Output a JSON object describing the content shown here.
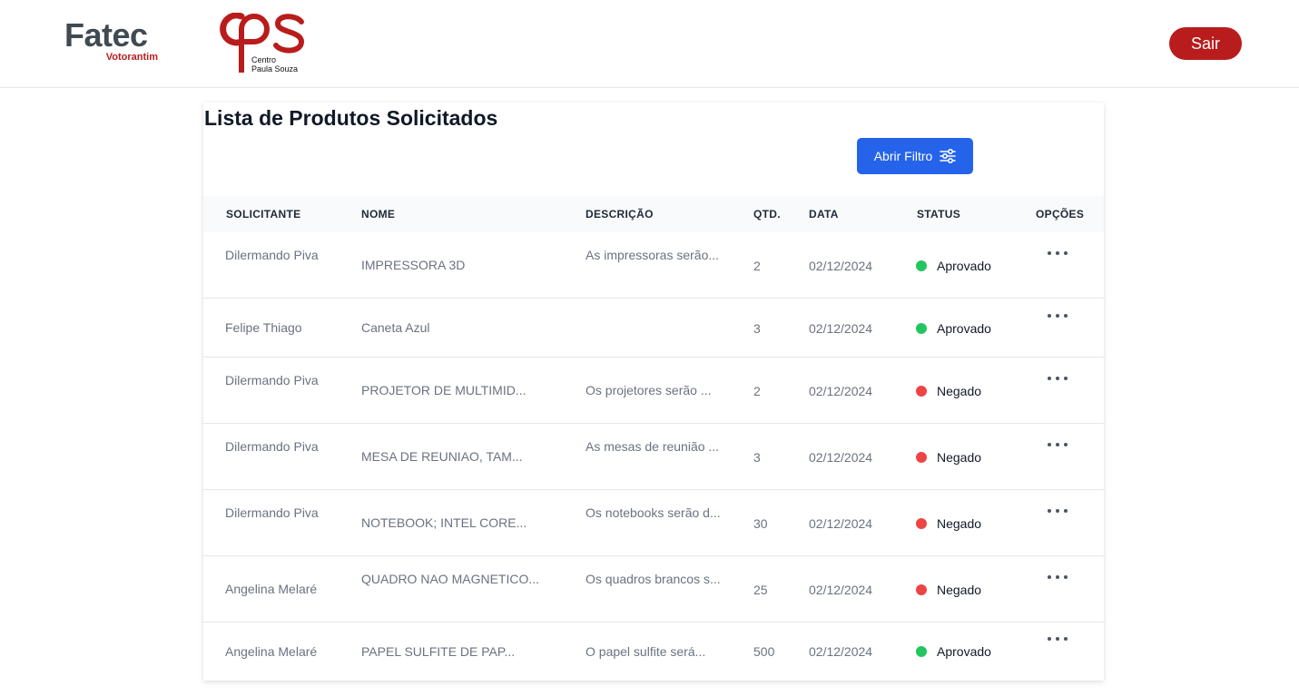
{
  "header": {
    "fatec_logo": {
      "name": "Fatec",
      "subtitle": "Votorantim"
    },
    "cps_logo": {
      "line1": "Centro",
      "line2": "Paula Souza"
    },
    "logout_label": "Sair"
  },
  "colors": {
    "primary_blue": "#2563eb",
    "brand_red": "#b91c1c",
    "approved": "#22c55e",
    "denied": "#ef4444"
  },
  "page": {
    "title": "Lista de Produtos Solicitados",
    "filter_button": {
      "label": "Abrir Filtro",
      "icon": "sliders-icon"
    }
  },
  "table": {
    "columns": [
      "SOLICITANTE",
      "NOME",
      "DESCRIÇÃO",
      "QTD.",
      "DATA",
      "STATUS",
      "OPÇÕES"
    ],
    "rows": [
      {
        "solicitante": "Dilermando Piva",
        "nome": "IMPRESSORA 3D",
        "descricao": "As impressoras serão...",
        "qtd": "2",
        "data": "02/12/2024",
        "status": "Aprovado",
        "status_type": "approved"
      },
      {
        "solicitante": "Felipe Thiago",
        "nome": "Caneta Azul",
        "descricao": "",
        "qtd": "3",
        "data": "02/12/2024",
        "status": "Aprovado",
        "status_type": "approved"
      },
      {
        "solicitante": "Dilermando Piva",
        "nome": "PROJETOR DE MULTIMID...",
        "descricao": "Os projetores serão ...",
        "qtd": "2",
        "data": "02/12/2024",
        "status": "Negado",
        "status_type": "denied"
      },
      {
        "solicitante": "Dilermando Piva",
        "nome": "MESA DE REUNIAO, TAM...",
        "descricao": "As mesas de reunião ...",
        "qtd": "3",
        "data": "02/12/2024",
        "status": "Negado",
        "status_type": "denied"
      },
      {
        "solicitante": "Dilermando Piva",
        "nome": "NOTEBOOK; INTEL CORE...",
        "descricao": "Os notebooks serão d...",
        "qtd": "30",
        "data": "02/12/2024",
        "status": "Negado",
        "status_type": "denied"
      },
      {
        "solicitante": "Angelina Melaré",
        "nome": "QUADRO NAO MAGNETICO...",
        "descricao": "Os quadros brancos s...",
        "qtd": "25",
        "data": "02/12/2024",
        "status": "Negado",
        "status_type": "denied"
      },
      {
        "solicitante": "Angelina Melaré",
        "nome": "PAPEL SULFITE DE PAP...",
        "descricao": "O papel sulfite será...",
        "qtd": "500",
        "data": "02/12/2024",
        "status": "Aprovado",
        "status_type": "approved"
      }
    ]
  }
}
